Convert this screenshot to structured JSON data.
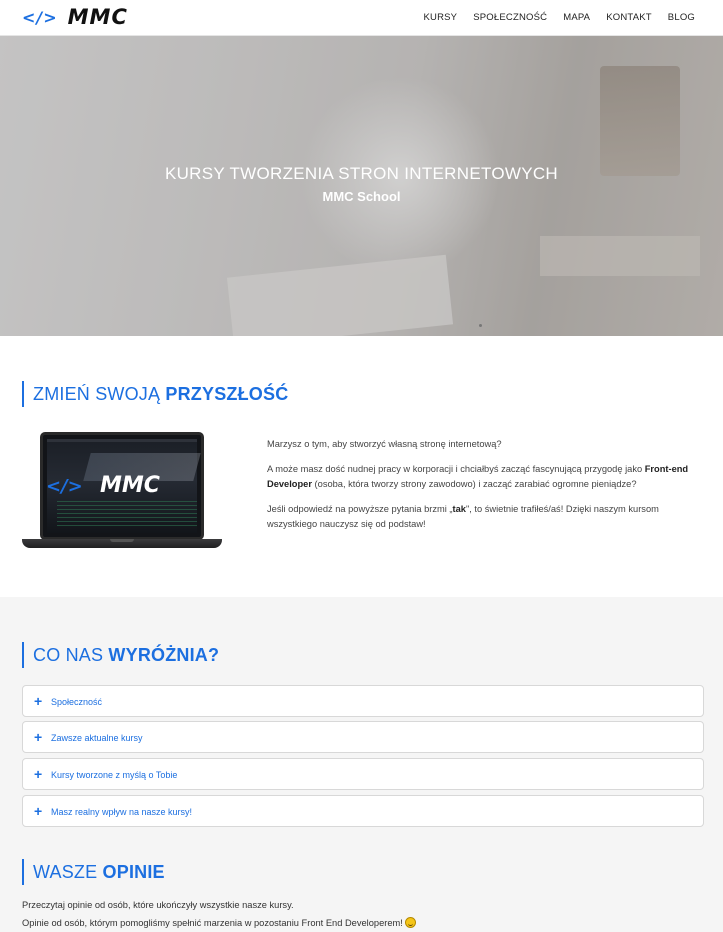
{
  "header": {
    "logo_code": "</>",
    "logo_text": "MMC",
    "nav": [
      "KURSY",
      "SPOŁECZNOŚĆ",
      "MAPA",
      "KONTAKT",
      "BLOG"
    ]
  },
  "hero": {
    "title": "KURSY TWORZENIA STRON INTERNETOWYCH",
    "subtitle": "MMC School"
  },
  "section_future": {
    "heading_light": "ZMIEŃ SWOJĄ ",
    "heading_bold": "PRZYSZŁOŚĆ",
    "laptop_screen_code": "</>",
    "laptop_screen_text": "MMC",
    "p1": "Marzysz o tym, aby stworzyć własną stronę internetową?",
    "p2_before": "A może masz dość nudnej pracy w korporacji i chciałbyś zacząć fascynującą przygodę jako ",
    "p2_bold": "Front-end Developer",
    "p2_after": " (osoba, która tworzy strony zawodowo) i zacząć zarabiać ogromne pieniądze?",
    "p3_before": "Jeśli odpowiedź na powyższe pytania brzmi „",
    "p3_bold": "tak",
    "p3_after": "\", to świetnie trafiłeś/aś! Dzięki naszym kursom wszystkiego nauczysz się od podstaw!"
  },
  "section_features": {
    "heading_light": "CO NAS ",
    "heading_bold": "WYRÓŻNIA?",
    "items": [
      "Społeczność",
      "Zawsze aktualne kursy",
      "Kursy tworzone z myślą o Tobie",
      "Masz realny wpływ na nasze kursy!"
    ]
  },
  "section_opinions": {
    "heading_light": "WASZE ",
    "heading_bold": "OPINIE",
    "line1": "Przeczytaj opinie od osób, które ukończyły wszystkie nasze kursy.",
    "line2": "Opinie od osób, którym pomogliśmy spełnić marzenia w pozostaniu Front End Developerem!"
  },
  "colors": {
    "accent": "#1c6fe0",
    "section_bg": "#f5f5f5"
  },
  "icons": {
    "accordion": "plus-icon",
    "emoji": "smile-emoji-icon"
  }
}
